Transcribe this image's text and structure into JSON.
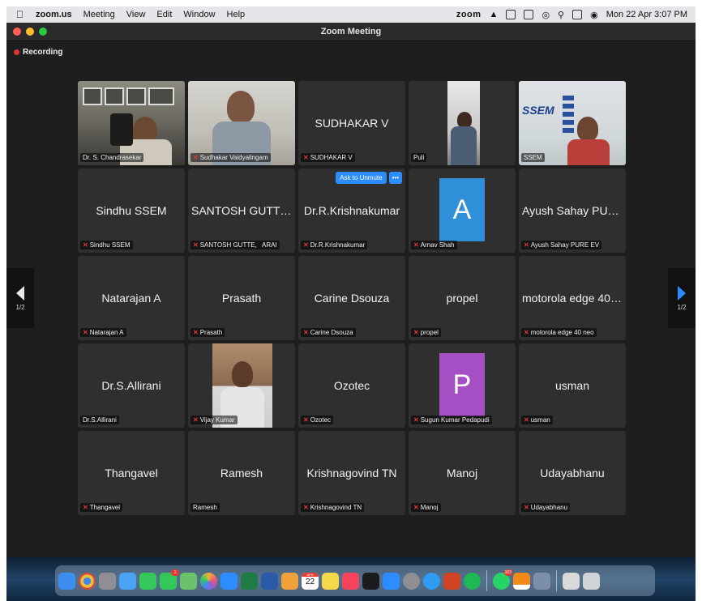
{
  "menubar": {
    "app": "zoom.us",
    "items": [
      "Meeting",
      "View",
      "Edit",
      "Window",
      "Help"
    ],
    "zoom_logo": "zoom",
    "datetime": "Mon 22 Apr  3:07 PM"
  },
  "window": {
    "title": "Zoom Meeting"
  },
  "recording": {
    "label": "Recording",
    "color": "#e0342c"
  },
  "pager": {
    "page_left": "1/2",
    "page_right": "1/2"
  },
  "participants": [
    {
      "id": "chandrasekar",
      "name": "Dr. S. Chandrasekar",
      "display": "",
      "video": true,
      "muted": false,
      "active_speaker": true
    },
    {
      "id": "sudhakar-vaidyalingam",
      "name": "Sudhakar Vaidyalingam",
      "display": "",
      "video": true,
      "muted": true
    },
    {
      "id": "sudhakar-v",
      "name": "SUDHAKAR V",
      "display": "SUDHAKAR V",
      "video": false,
      "muted": true
    },
    {
      "id": "puli",
      "name": "Puli",
      "display": "",
      "video": true,
      "muted": false
    },
    {
      "id": "ssem",
      "name": "SSEM",
      "display": "",
      "video": true,
      "muted": false
    },
    {
      "id": "sindhu",
      "name": "Sindhu SSEM",
      "display": "Sindhu SSEM",
      "video": false,
      "muted": true
    },
    {
      "id": "santosh",
      "name": "SANTOSH GUTTE,   ARAI",
      "display": "SANTOSH GUTTE,...",
      "video": false,
      "muted": true
    },
    {
      "id": "krishnakumar",
      "name": "Dr.R.Krishnakumar",
      "display": "Dr.R.Krishnakumar",
      "video": false,
      "muted": true,
      "hover_controls": {
        "unmute": "Ask to Unmute",
        "more": "•••"
      }
    },
    {
      "id": "arnav",
      "name": "Arnav Shah",
      "display": "",
      "avatar_letter": "A",
      "avatar_color": "#2f8fd8",
      "video": false,
      "muted": true
    },
    {
      "id": "ayush",
      "name": "Ayush Sahay PURE EV",
      "display": "Ayush Sahay PURE EV",
      "video": false,
      "muted": true
    },
    {
      "id": "natarajan",
      "name": "Natarajan A",
      "display": "Natarajan A",
      "video": false,
      "muted": true
    },
    {
      "id": "prasath",
      "name": "Prasath",
      "display": "Prasath",
      "video": false,
      "muted": true
    },
    {
      "id": "carine",
      "name": "Carine Dsouza",
      "display": "Carine Dsouza",
      "video": false,
      "muted": true
    },
    {
      "id": "propel",
      "name": "propel",
      "display": "propel",
      "video": false,
      "muted": true
    },
    {
      "id": "motorola",
      "name": "motorola edge 40 neo",
      "display": "motorola edge 40 neo",
      "video": false,
      "muted": true
    },
    {
      "id": "allirani",
      "name": "Dr.S.Allirani",
      "display": "Dr.S.Allirani",
      "video": false,
      "muted": false
    },
    {
      "id": "vijay",
      "name": "Vijay Kumar",
      "display": "",
      "video": true,
      "muted": true
    },
    {
      "id": "ozotec",
      "name": "Ozotec",
      "display": "Ozotec",
      "video": false,
      "muted": true
    },
    {
      "id": "sugun",
      "name": "Sugun Kumar Pedapudi",
      "display": "",
      "avatar_letter": "P",
      "avatar_color": "#a64fc4",
      "video": false,
      "muted": true
    },
    {
      "id": "usman",
      "name": "usman",
      "display": "usman",
      "video": false,
      "muted": true
    },
    {
      "id": "thangavel",
      "name": "Thangavel",
      "display": "Thangavel",
      "video": false,
      "muted": true
    },
    {
      "id": "ramesh",
      "name": "Ramesh",
      "display": "Ramesh",
      "video": false,
      "muted": false
    },
    {
      "id": "krishnagovind",
      "name": "Krishnagovind TN",
      "display": "Krishnagovind TN",
      "video": false,
      "muted": true
    },
    {
      "id": "manoj",
      "name": "Manoj",
      "display": "Manoj",
      "video": false,
      "muted": true
    },
    {
      "id": "udayabhanu",
      "name": "Udayabhanu",
      "display": "Udayabhanu",
      "video": false,
      "muted": true
    }
  ],
  "dock": {
    "calendar_month": "APR",
    "calendar_day": "22",
    "messages_badge": "1",
    "whatsapp_badge": "103",
    "apps": [
      {
        "name": "finder-icon",
        "color": "#3d8ef0"
      },
      {
        "name": "chrome-icon",
        "color": "#e8c13a"
      },
      {
        "name": "launchpad-icon",
        "color": "#8e8e93"
      },
      {
        "name": "mail-icon",
        "color": "#4aa3f5"
      },
      {
        "name": "facetime-icon",
        "color": "#34c759"
      },
      {
        "name": "messages-icon",
        "color": "#34c759"
      },
      {
        "name": "maps-icon",
        "color": "#6cc26b"
      },
      {
        "name": "photos-icon",
        "color": "#f2b233"
      },
      {
        "name": "zoom-icon",
        "color": "#2d8cff"
      },
      {
        "name": "excel-icon",
        "color": "#1f7a45"
      },
      {
        "name": "word-icon",
        "color": "#2b5aa8"
      },
      {
        "name": "preview-icon",
        "color": "#f0a13a"
      },
      {
        "name": "calendar-icon",
        "color": "#ffffff"
      },
      {
        "name": "notes-icon",
        "color": "#f7d84b"
      },
      {
        "name": "music-icon",
        "color": "#f6425a"
      },
      {
        "name": "appletv-icon",
        "color": "#1c1c1e"
      },
      {
        "name": "appstore-icon",
        "color": "#2d8cff"
      },
      {
        "name": "settings-icon",
        "color": "#8e8e93"
      },
      {
        "name": "safari-icon",
        "color": "#2d9cf2"
      },
      {
        "name": "powerpoint-icon",
        "color": "#d04423"
      },
      {
        "name": "spotify-icon",
        "color": "#1db954"
      },
      {
        "name": "whatsapp-icon",
        "color": "#25d366"
      },
      {
        "name": "vlc-icon",
        "color": "#f28a1a"
      },
      {
        "name": "disk-utility-icon",
        "color": "#7d8fa8"
      },
      {
        "name": "documents-stack-icon",
        "color": "#d9d9d9"
      },
      {
        "name": "trash-icon",
        "color": "#cfd4d9"
      }
    ]
  }
}
